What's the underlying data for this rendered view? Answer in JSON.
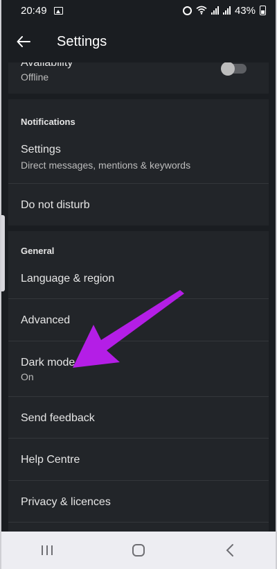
{
  "status_bar": {
    "time": "20:49",
    "battery_percent": "43%"
  },
  "app_bar": {
    "title": "Settings"
  },
  "account": {
    "availability_label": "Availability",
    "availability_value": "Offline",
    "availability_toggle_on": false
  },
  "notifications": {
    "section_label": "Notifications",
    "settings_title": "Settings",
    "settings_sub": "Direct messages, mentions & keywords",
    "dnd_title": "Do not disturb"
  },
  "general": {
    "section_label": "General",
    "items": [
      {
        "title": "Language & region"
      },
      {
        "title": "Advanced"
      },
      {
        "title": "Dark mode",
        "sub": "On"
      },
      {
        "title": "Send feedback"
      },
      {
        "title": "Help Centre"
      },
      {
        "title": "Privacy & licences"
      }
    ]
  },
  "annotation": {
    "arrow_color": "#b41ee6"
  },
  "colors": {
    "background": "#1a1d21",
    "card": "#222529",
    "nav_bar": "#ededf2"
  }
}
